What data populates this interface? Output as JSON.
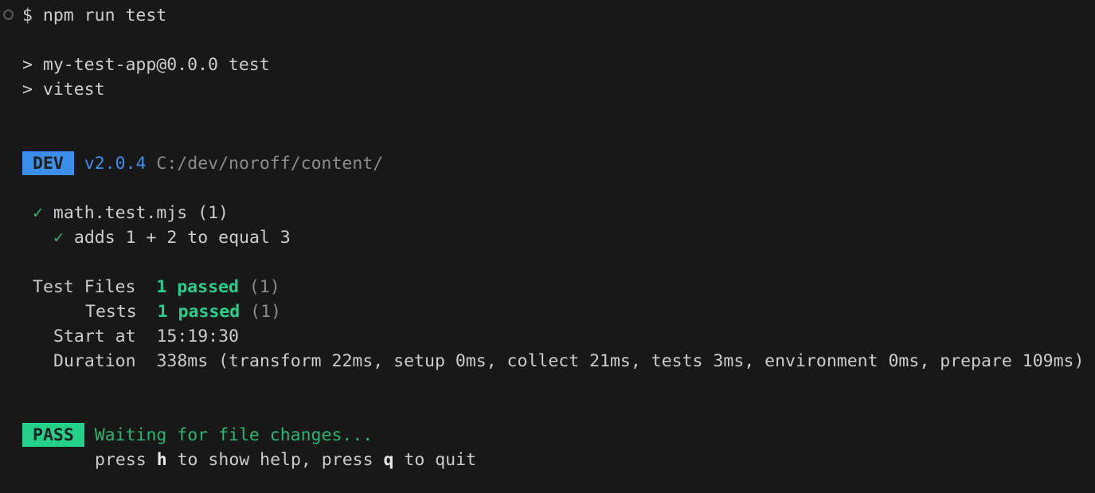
{
  "colors": {
    "background": "#181818",
    "text": "#cccccc",
    "dim": "#8b8b8b",
    "dev_badge": "#3b8eea",
    "pass_badge": "#23d18b",
    "success": "#23d18b"
  },
  "prompt": {
    "status_icon": "circle-outline-icon",
    "symbol": "$",
    "command": "npm run test"
  },
  "script_lines": [
    "> my-test-app@0.0.0 test",
    "> vitest"
  ],
  "dev_header": {
    "badge": "DEV",
    "version": "v2.0.4",
    "path": "C:/dev/noroff/content/"
  },
  "results": {
    "file": {
      "check_icon": "✓",
      "name": "math.test.mjs (1)"
    },
    "test": {
      "check_icon": "✓",
      "name": "adds 1 + 2 to equal 3"
    }
  },
  "summary": {
    "test_files": {
      "label": "Test Files",
      "passed": "1 passed",
      "total": "(1)"
    },
    "tests": {
      "label": "Tests",
      "passed": "1 passed",
      "total": "(1)"
    },
    "start_at": {
      "label": "Start at",
      "value": "15:19:30"
    },
    "duration": {
      "label": "Duration",
      "value": "338ms (transform 22ms, setup 0ms, collect 21ms, tests 3ms, environment 0ms, prepare 109ms)"
    }
  },
  "footer": {
    "badge": "PASS",
    "status": "Waiting for file changes...",
    "help": {
      "press1": "press",
      "key_help": "h",
      "to_help": "to show help, press",
      "key_quit": "q",
      "to_quit": "to quit"
    }
  }
}
